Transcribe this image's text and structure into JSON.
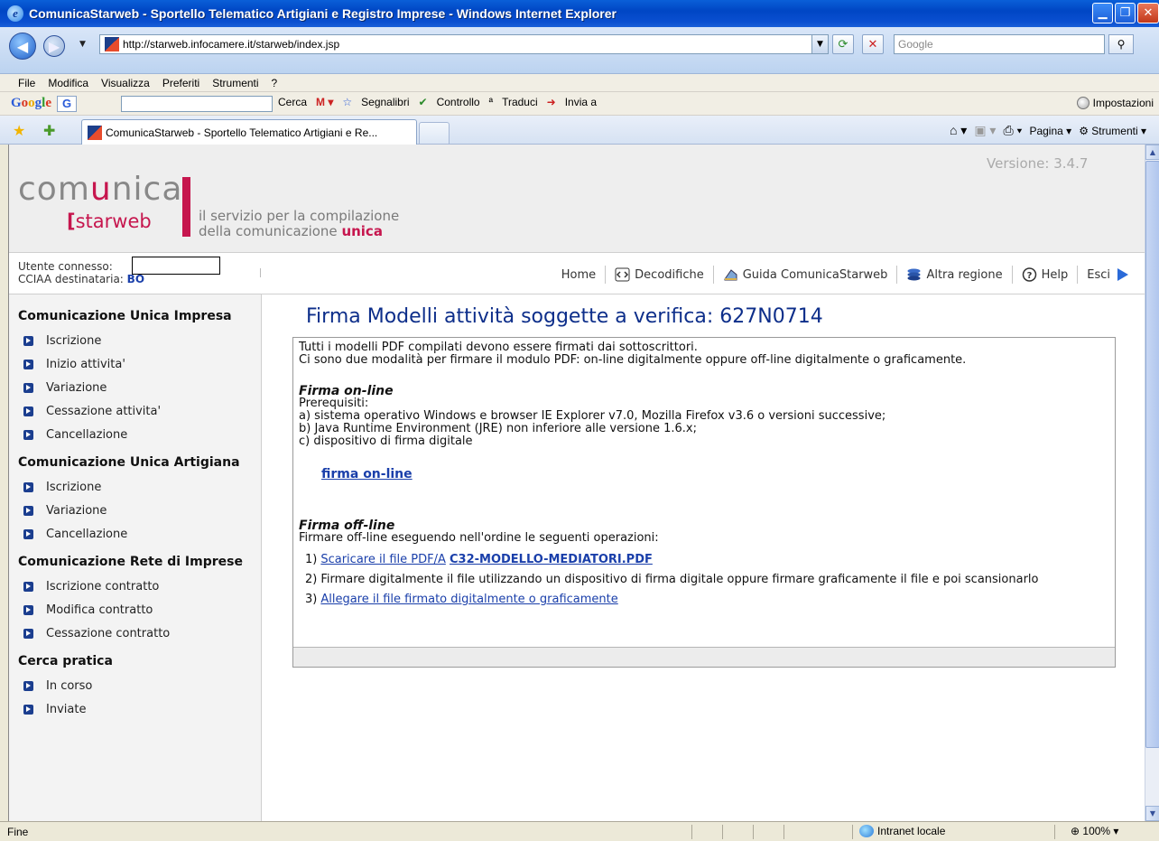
{
  "browser": {
    "title": "ComunicaStarweb - Sportello Telematico Artigiani e Registro Imprese - Windows Internet Explorer",
    "url": "http://starweb.infocamere.it/starweb/index.jsp",
    "search_placeholder": "Google",
    "menu": [
      "File",
      "Modifica",
      "Visualizza",
      "Preferiti",
      "Strumenti",
      "?"
    ],
    "google_toolbar": {
      "logo": "Google",
      "cerca": "Cerca",
      "segnalibri": "Segnalibri",
      "controllo": "Controllo",
      "traduci": "Traduci",
      "invia": "Invia a",
      "impostazioni": "Impostazioni"
    },
    "tab_title": "ComunicaStarweb - Sportello Telematico Artigiani e Re...",
    "command_bar": {
      "pagina": "Pagina",
      "strumenti": "Strumenti"
    },
    "status": {
      "left": "Fine",
      "zone": "Intranet locale",
      "zoom": "100%"
    }
  },
  "site": {
    "logo_main": "comunica",
    "logo_sub": "starweb",
    "tagline_line1": "il servizio per la compilazione",
    "tagline_line2_prefix": "della comunicazione",
    "tagline_line2_accent": "unica",
    "version": "Versione: 3.4.7"
  },
  "user": {
    "connected_label": "Utente connesso:",
    "connected_value": "",
    "cciaa_label": "CCIAA destinataria:",
    "cciaa_value": "BO"
  },
  "topnav": {
    "home": "Home",
    "decodifiche": "Decodifiche",
    "guida": "Guida ComunicaStarweb",
    "altra_regione": "Altra regione",
    "help": "Help",
    "esci": "Esci"
  },
  "sidebar": {
    "sections": [
      {
        "title": "Comunicazione Unica Impresa",
        "items": [
          "Iscrizione",
          "Inizio attivita'",
          "Variazione",
          "Cessazione attivita'",
          "Cancellazione"
        ]
      },
      {
        "title": "Comunicazione Unica Artigiana",
        "items": [
          "Iscrizione",
          "Variazione",
          "Cancellazione"
        ]
      },
      {
        "title": "Comunicazione Rete di Imprese",
        "items": [
          "Iscrizione contratto",
          "Modifica contratto",
          "Cessazione contratto"
        ]
      },
      {
        "title": "Cerca pratica",
        "items": [
          "In corso",
          "Inviate"
        ]
      }
    ]
  },
  "main": {
    "title": "Firma Modelli attività soggette a verifica: 627N0714",
    "intro_line1": "Tutti i modelli PDF compilati devono essere firmati dai sottoscrittori.",
    "intro_line2": "Ci sono due modalità per firmare il modulo PDF: on-line digitalmente oppure off-line digitalmente o graficamente.",
    "online_heading": "Firma on-line",
    "prereq_label": "Prerequisiti:",
    "prereq_a": "a) sistema operativo Windows e browser IE Explorer v7.0, Mozilla Firefox v3.6 o versioni successive;",
    "prereq_b": "b) Java Runtime Environment (JRE) non inferiore alle versione 1.6.x;",
    "prereq_c": "c) dispositivo di firma digitale",
    "online_link": "firma on-line",
    "offline_heading": "Firma off-line",
    "offline_intro": "Firmare off-line eseguendo nell'ordine le seguenti operazioni:",
    "step1_num": "1)",
    "step1_link": "Scaricare il file PDF/A",
    "step1_file": "C32-MODELLO-MEDIATORI.PDF",
    "step2_num": "2)",
    "step2_text": "Firmare digitalmente il file utilizzando un dispositivo di firma digitale oppure firmare graficamente il file e poi scansionarlo",
    "step3_num": "3)",
    "step3_link": "Allegare il file firmato digitalmente o graficamente"
  }
}
